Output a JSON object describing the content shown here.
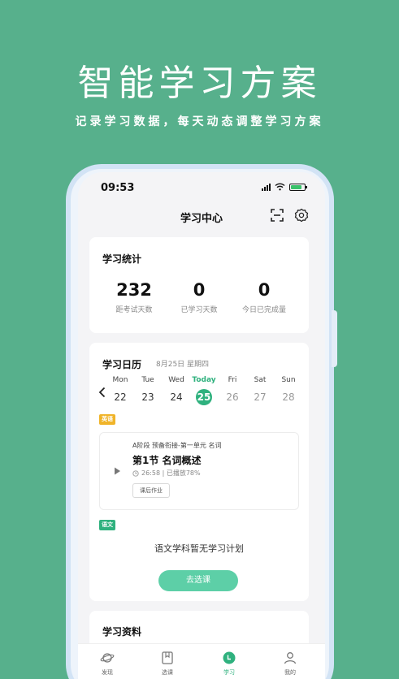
{
  "hero": {
    "title": "智能学习方案",
    "subtitle": "记录学习数据，每天动态调整学习方案"
  },
  "status_bar": {
    "time": "09:53"
  },
  "header": {
    "title": "学习中心",
    "scan_icon": "scan-icon",
    "settings_icon": "gear-icon"
  },
  "stats": {
    "title": "学习统计",
    "items": [
      {
        "value": "232",
        "label": "距考试天数"
      },
      {
        "value": "0",
        "label": "已学习天数"
      },
      {
        "value": "0",
        "label": "今日已完成量"
      }
    ]
  },
  "calendar": {
    "title": "学习日历",
    "date": "8月25日  星期四",
    "days": [
      {
        "name": "Mon",
        "date": "22"
      },
      {
        "name": "Tue",
        "date": "23"
      },
      {
        "name": "Wed",
        "date": "24"
      },
      {
        "name": "Today",
        "date": "25"
      },
      {
        "name": "Fri",
        "date": "26"
      },
      {
        "name": "Sat",
        "date": "27"
      },
      {
        "name": "Sun",
        "date": "28"
      }
    ]
  },
  "english": {
    "tag": "英语",
    "lesson": {
      "subtitle": "A阶段 预备衔接-第一单元  名词",
      "title": "第1节  名词概述",
      "meta": "26:58 | 已播放78%",
      "homework_button": "课后作业"
    }
  },
  "chinese": {
    "tag": "语文",
    "empty_text": "语文学科暂无学习计划",
    "choose_button": "去选课"
  },
  "resources": {
    "title": "学习资料"
  },
  "tabbar": {
    "items": [
      {
        "label": "发现",
        "icon": "planet-icon"
      },
      {
        "label": "选课",
        "icon": "book-icon"
      },
      {
        "label": "学习",
        "icon": "study-icon"
      },
      {
        "label": "我的",
        "icon": "user-icon"
      }
    ]
  },
  "colors": {
    "brand": "#57b08c",
    "accent": "#2fb17e",
    "button": "#5dcfa7",
    "tag_yellow": "#f0b429"
  }
}
